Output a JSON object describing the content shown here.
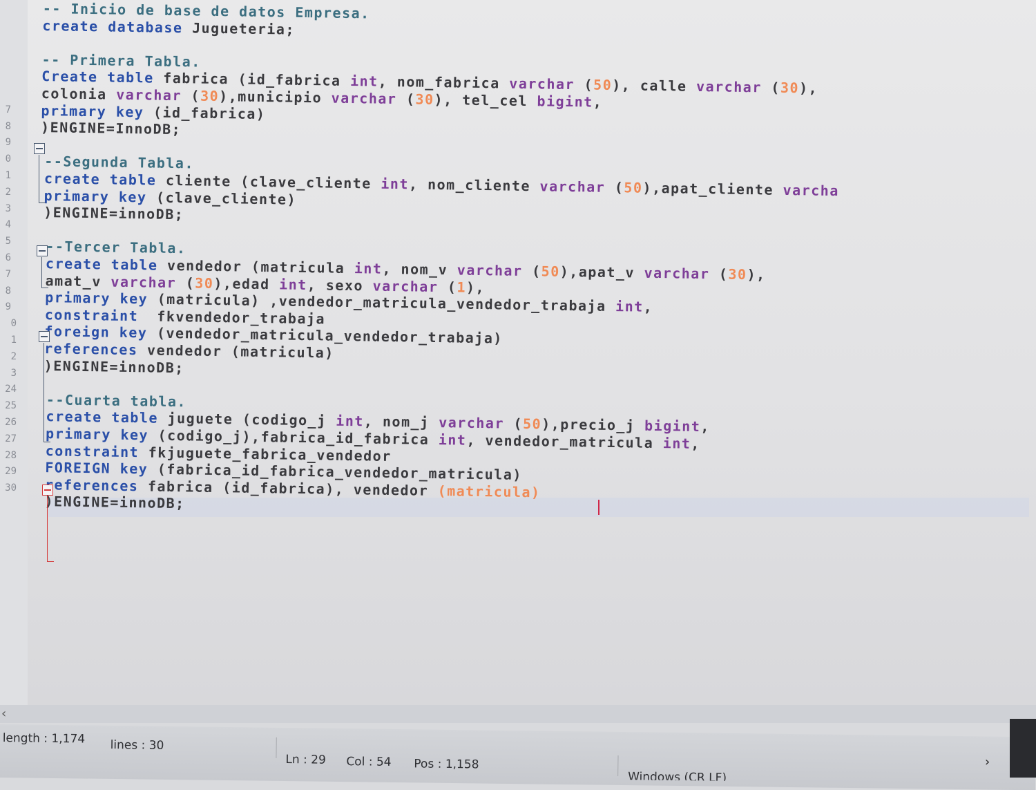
{
  "editor": {
    "line_numbers": [
      "7",
      "8",
      "9",
      "0",
      "1",
      "2",
      "3",
      "4",
      "5",
      "6",
      "7",
      "8",
      "9",
      "0",
      "1",
      "2",
      "3",
      "24",
      "25",
      "26",
      "27",
      "28",
      "29",
      "30"
    ],
    "lines": [
      [
        {
          "t": "-- Inicio de base de datos Empresa.",
          "c": "cm"
        }
      ],
      [
        {
          "t": "create database",
          "c": "kw"
        },
        {
          "t": " Jugueteria;",
          "c": "pl"
        }
      ],
      [],
      [
        {
          "t": "-- Primera Tabla.",
          "c": "cm"
        }
      ],
      [
        {
          "t": "Create table",
          "c": "kw"
        },
        {
          "t": " fabrica (id_fabrica ",
          "c": "pl"
        },
        {
          "t": "int",
          "c": "ty"
        },
        {
          "t": ", nom_fabrica ",
          "c": "pl"
        },
        {
          "t": "varchar",
          "c": "ty"
        },
        {
          "t": " (",
          "c": "pl"
        },
        {
          "t": "50",
          "c": "num"
        },
        {
          "t": "), calle ",
          "c": "pl"
        },
        {
          "t": "varchar",
          "c": "ty"
        },
        {
          "t": " (",
          "c": "pl"
        },
        {
          "t": "30",
          "c": "num"
        },
        {
          "t": "),",
          "c": "pl"
        }
      ],
      [
        {
          "t": "colonia ",
          "c": "pl"
        },
        {
          "t": "varchar",
          "c": "ty"
        },
        {
          "t": " (",
          "c": "pl"
        },
        {
          "t": "30",
          "c": "num"
        },
        {
          "t": "),municipio ",
          "c": "pl"
        },
        {
          "t": "varchar",
          "c": "ty"
        },
        {
          "t": " (",
          "c": "pl"
        },
        {
          "t": "30",
          "c": "num"
        },
        {
          "t": "), tel_cel ",
          "c": "pl"
        },
        {
          "t": "bigint",
          "c": "ty"
        },
        {
          "t": ",",
          "c": "pl"
        }
      ],
      [
        {
          "t": "primary key",
          "c": "kw"
        },
        {
          "t": " (id_fabrica)",
          "c": "pl"
        }
      ],
      [
        {
          "t": ")ENGINE=InnoDB;",
          "c": "pl"
        }
      ],
      [],
      [
        {
          "t": "--Segunda Tabla.",
          "c": "cm"
        }
      ],
      [
        {
          "t": "create table",
          "c": "kw"
        },
        {
          "t": " cliente (clave_cliente ",
          "c": "pl"
        },
        {
          "t": "int",
          "c": "ty"
        },
        {
          "t": ", nom_cliente ",
          "c": "pl"
        },
        {
          "t": "varchar",
          "c": "ty"
        },
        {
          "t": " (",
          "c": "pl"
        },
        {
          "t": "50",
          "c": "num"
        },
        {
          "t": "),apat_cliente ",
          "c": "pl"
        },
        {
          "t": "varcha",
          "c": "ty"
        }
      ],
      [
        {
          "t": "primary key",
          "c": "kw"
        },
        {
          "t": " (clave_cliente)",
          "c": "pl"
        }
      ],
      [
        {
          "t": ")ENGINE=innoDB;",
          "c": "pl"
        }
      ],
      [],
      [
        {
          "t": "--Tercer Tabla.",
          "c": "cm"
        }
      ],
      [
        {
          "t": "create table",
          "c": "kw"
        },
        {
          "t": " vendedor (matricula ",
          "c": "pl"
        },
        {
          "t": "int",
          "c": "ty"
        },
        {
          "t": ", nom_v ",
          "c": "pl"
        },
        {
          "t": "varchar",
          "c": "ty"
        },
        {
          "t": " (",
          "c": "pl"
        },
        {
          "t": "50",
          "c": "num"
        },
        {
          "t": "),apat_v ",
          "c": "pl"
        },
        {
          "t": "varchar",
          "c": "ty"
        },
        {
          "t": " (",
          "c": "pl"
        },
        {
          "t": "30",
          "c": "num"
        },
        {
          "t": "),",
          "c": "pl"
        }
      ],
      [
        {
          "t": "amat_v ",
          "c": "pl"
        },
        {
          "t": "varchar",
          "c": "ty"
        },
        {
          "t": " (",
          "c": "pl"
        },
        {
          "t": "30",
          "c": "num"
        },
        {
          "t": "),edad ",
          "c": "pl"
        },
        {
          "t": "int",
          "c": "ty"
        },
        {
          "t": ", sexo ",
          "c": "pl"
        },
        {
          "t": "varchar",
          "c": "ty"
        },
        {
          "t": " (",
          "c": "pl"
        },
        {
          "t": "1",
          "c": "num"
        },
        {
          "t": "),",
          "c": "pl"
        }
      ],
      [
        {
          "t": "primary key",
          "c": "kw"
        },
        {
          "t": " (matricula) ,vendedor_matricula_vendedor_trabaja ",
          "c": "pl"
        },
        {
          "t": "int",
          "c": "ty"
        },
        {
          "t": ",",
          "c": "pl"
        }
      ],
      [
        {
          "t": "constraint",
          "c": "kw"
        },
        {
          "t": "  fkvendedor_trabaja",
          "c": "pl"
        }
      ],
      [
        {
          "t": "foreign key",
          "c": "kw"
        },
        {
          "t": " (vendedor_matricula_vendedor_trabaja)",
          "c": "pl"
        }
      ],
      [
        {
          "t": "references",
          "c": "kw"
        },
        {
          "t": " vendedor (matricula)",
          "c": "pl"
        }
      ],
      [
        {
          "t": ")ENGINE=innoDB;",
          "c": "pl"
        }
      ],
      [],
      [
        {
          "t": "--Cuarta tabla.",
          "c": "cm"
        }
      ],
      [
        {
          "t": "create table",
          "c": "kw"
        },
        {
          "t": " juguete (codigo_j ",
          "c": "pl"
        },
        {
          "t": "int",
          "c": "ty"
        },
        {
          "t": ", nom_j ",
          "c": "pl"
        },
        {
          "t": "varchar",
          "c": "ty"
        },
        {
          "t": " (",
          "c": "pl"
        },
        {
          "t": "50",
          "c": "num"
        },
        {
          "t": "),precio_j ",
          "c": "pl"
        },
        {
          "t": "bigint",
          "c": "ty"
        },
        {
          "t": ",",
          "c": "pl"
        }
      ],
      [
        {
          "t": "primary key",
          "c": "kw"
        },
        {
          "t": " (codigo_j),fabrica_id_fabrica ",
          "c": "pl"
        },
        {
          "t": "int",
          "c": "ty"
        },
        {
          "t": ", vendedor_matricula ",
          "c": "pl"
        },
        {
          "t": "int",
          "c": "ty"
        },
        {
          "t": ",",
          "c": "pl"
        }
      ],
      [
        {
          "t": "constraint",
          "c": "kw"
        },
        {
          "t": " fkjuguete_fabrica_vendedor",
          "c": "pl"
        }
      ],
      [
        {
          "t": "FOREIGN key",
          "c": "kw"
        },
        {
          "t": " (fabrica_id_fabrica_vendedor_matricula)",
          "c": "pl"
        }
      ],
      [
        {
          "t": "references",
          "c": "kw"
        },
        {
          "t": " fabrica (id_fabrica), vendedor ",
          "c": "pl"
        },
        {
          "t": "(matricula)",
          "c": "num"
        }
      ],
      [
        {
          "t": ")ENGINE=innoDB;",
          "c": "pl"
        }
      ]
    ]
  },
  "statusbar": {
    "length": "length : 1,174",
    "lines": "lines : 30",
    "ln": "Ln : 29",
    "col": "Col : 54",
    "pos": "Pos : 1,158",
    "eol": "Windows (CR LF)"
  },
  "icons": {
    "scroll_left": "‹",
    "scroll_right": "›"
  },
  "colors": {
    "keyword": "#2a4fa8",
    "type": "#7e3e98",
    "number": "#f08a55",
    "comment": "#3b6e80",
    "caret": "#d0284a"
  }
}
